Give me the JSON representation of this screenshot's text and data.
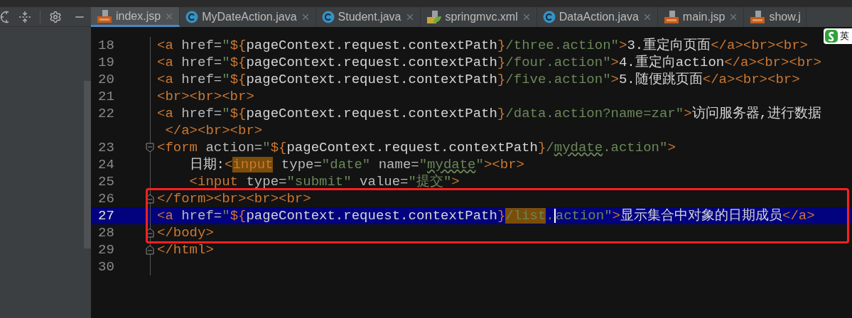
{
  "tool_window": {
    "scrollbar": true
  },
  "tabs": [
    {
      "label": "index.jsp",
      "kind": "jsp",
      "closable": true,
      "selected": true
    },
    {
      "label": "MyDateAction.java",
      "kind": "class",
      "closable": true,
      "selected": false
    },
    {
      "label": "Student.java",
      "kind": "class",
      "closable": true,
      "selected": false
    },
    {
      "label": "springmvc.xml",
      "kind": "xml",
      "closable": true,
      "selected": false
    },
    {
      "label": "DataAction.java",
      "kind": "class",
      "closable": true,
      "selected": false
    },
    {
      "label": "main.jsp",
      "kind": "jsp",
      "closable": true,
      "selected": false
    },
    {
      "label": "show.j",
      "kind": "jsp",
      "closable": false,
      "selected": false
    }
  ],
  "ime_indicator": {
    "label": "英"
  },
  "editor": {
    "lines": [
      {
        "number": "18",
        "selected": false,
        "tokens": [
          {
            "kind": "tag",
            "text": "<a"
          },
          {
            "kind": "attr",
            "text": " href="
          },
          {
            "kind": "string",
            "text": "\""
          },
          {
            "kind": "el",
            "text": "${"
          },
          {
            "kind": "text",
            "text": "pageContext.request.contextPath"
          },
          {
            "kind": "el",
            "text": "}"
          },
          {
            "kind": "string",
            "text": "/three.action\""
          },
          {
            "kind": "tag",
            "text": ">"
          },
          {
            "kind": "text",
            "text": "3.重定向页面"
          },
          {
            "kind": "tag",
            "text": "</a><br><br>"
          }
        ]
      },
      {
        "number": "19",
        "selected": false,
        "tokens": [
          {
            "kind": "tag",
            "text": "<a"
          },
          {
            "kind": "attr",
            "text": " href="
          },
          {
            "kind": "string",
            "text": "\""
          },
          {
            "kind": "el",
            "text": "${"
          },
          {
            "kind": "text",
            "text": "pageContext.request.contextPath"
          },
          {
            "kind": "el",
            "text": "}"
          },
          {
            "kind": "string",
            "text": "/four.action\""
          },
          {
            "kind": "tag",
            "text": ">"
          },
          {
            "kind": "text",
            "text": "4.重定向action"
          },
          {
            "kind": "tag",
            "text": "</a><br><br>"
          }
        ]
      },
      {
        "number": "20",
        "selected": false,
        "tokens": [
          {
            "kind": "tag",
            "text": "<a"
          },
          {
            "kind": "attr",
            "text": " href="
          },
          {
            "kind": "string",
            "text": "\""
          },
          {
            "kind": "el",
            "text": "${"
          },
          {
            "kind": "text",
            "text": "pageContext.request.contextPath"
          },
          {
            "kind": "el",
            "text": "}"
          },
          {
            "kind": "string",
            "text": "/five.action\""
          },
          {
            "kind": "tag",
            "text": ">"
          },
          {
            "kind": "text",
            "text": "5.随便跳页面"
          },
          {
            "kind": "tag",
            "text": "</a><br><br>"
          }
        ]
      },
      {
        "number": "21",
        "selected": false,
        "tokens": [
          {
            "kind": "tag",
            "text": "<br><br><br>"
          }
        ]
      },
      {
        "number": "22",
        "selected": false,
        "tokens": [
          {
            "kind": "tag",
            "text": "<a"
          },
          {
            "kind": "attr",
            "text": " href="
          },
          {
            "kind": "string",
            "text": "\""
          },
          {
            "kind": "el",
            "text": "${"
          },
          {
            "kind": "text",
            "text": "pageContext.request.contextPath"
          },
          {
            "kind": "el",
            "text": "}"
          },
          {
            "kind": "string",
            "text": "/data.action?name=zar\""
          },
          {
            "kind": "tag",
            "text": ">"
          },
          {
            "kind": "text",
            "text": "访问服务器,进行数据"
          }
        ]
      },
      {
        "selected": false,
        "tokens": [
          {
            "kind": "tag",
            "text": " </a><br><br>"
          }
        ]
      },
      {
        "number": "23",
        "fold": {
          "kind": "open"
        },
        "selected": false,
        "tokens": [
          {
            "kind": "tag",
            "text": "<form"
          },
          {
            "kind": "attr",
            "text": " action="
          },
          {
            "kind": "string",
            "text": "\""
          },
          {
            "kind": "el",
            "text": "${"
          },
          {
            "kind": "text",
            "text": "pageContext.request.contextPath"
          },
          {
            "kind": "el",
            "text": "}"
          },
          {
            "kind": "string",
            "text": "/"
          },
          {
            "kind": "typo",
            "text": "mydate"
          },
          {
            "kind": "string",
            "text": ".action\""
          },
          {
            "kind": "tag",
            "text": ">"
          }
        ]
      },
      {
        "number": "24",
        "selected": false,
        "tokens": [
          {
            "kind": "text",
            "text": "    日期:"
          },
          {
            "kind": "tag",
            "text": "<"
          },
          {
            "kind": "match",
            "text": "input"
          },
          {
            "kind": "attr",
            "text": " type="
          },
          {
            "kind": "string",
            "text": "\"date\""
          },
          {
            "kind": "attr",
            "text": " name="
          },
          {
            "kind": "string",
            "text": "\""
          },
          {
            "kind": "typo",
            "text": "mydate"
          },
          {
            "kind": "string",
            "text": "\""
          },
          {
            "kind": "tag",
            "text": "><br>"
          }
        ]
      },
      {
        "number": "25",
        "selected": false,
        "tokens": [
          {
            "kind": "tag",
            "text": "    <input"
          },
          {
            "kind": "attr",
            "text": " type="
          },
          {
            "kind": "string",
            "text": "\"submit\""
          },
          {
            "kind": "attr",
            "text": " value="
          },
          {
            "kind": "string",
            "text": "\"提交\""
          },
          {
            "kind": "tag",
            "text": ">"
          }
        ]
      },
      {
        "number": "26",
        "fold": {
          "kind": "close"
        },
        "selected": false,
        "tokens": [
          {
            "kind": "tag",
            "text": "</form><br><br><br>"
          }
        ]
      },
      {
        "number": "27",
        "selected": true,
        "tokens": [
          {
            "kind": "tag",
            "text": "<a"
          },
          {
            "kind": "attr",
            "text": " href="
          },
          {
            "kind": "string",
            "text": "\""
          },
          {
            "kind": "el",
            "text": "${"
          },
          {
            "kind": "text",
            "text": "pageContext.request.contextPath"
          },
          {
            "kind": "el",
            "text": "}"
          },
          {
            "kind": "match_string",
            "text": "/list"
          },
          {
            "kind": "string",
            "text": "."
          },
          {
            "kind": "caret"
          },
          {
            "kind": "string",
            "text": "action\""
          },
          {
            "kind": "tag",
            "text": ">"
          },
          {
            "kind": "text",
            "text": "显示集合中对象的日期成员"
          },
          {
            "kind": "tag",
            "text": "</a>"
          }
        ]
      },
      {
        "number": "28",
        "fold": {
          "kind": "close"
        },
        "selected": false,
        "tokens": [
          {
            "kind": "tag",
            "text": "</body>"
          }
        ]
      },
      {
        "number": "29",
        "fold": {
          "kind": "close"
        },
        "selected": false,
        "tokens": [
          {
            "kind": "tag",
            "text": "</html>"
          }
        ]
      },
      {
        "number": "30",
        "selected": false
      }
    ],
    "annotation": {
      "kind": "rectangle"
    }
  }
}
